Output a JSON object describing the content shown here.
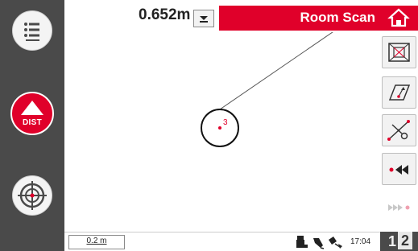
{
  "header": {
    "measurement_value": "0.652m",
    "title": "Room Scan"
  },
  "left_rail": {
    "dist_label": "DIST"
  },
  "canvas": {
    "point_label": "3"
  },
  "bottom_bar": {
    "scale_label": "0.2 m",
    "time": "17:04"
  },
  "page_indicator": {
    "page_one": "1",
    "page_two": "2"
  },
  "icons": {
    "menu": "list-menu-icon",
    "dist": "dist-measure-icon",
    "target": "crosshair-target-icon",
    "home": "home-icon",
    "room": "room-view-icon",
    "plane": "plane-icon",
    "tools": "scissors-tools-icon",
    "rewind": "rewind-icon",
    "forward": "forward-icon",
    "dropdown": "chevron-down-icon",
    "battery": "battery-icon",
    "probe": "probe-icon",
    "connect": "connection-icon"
  },
  "colors": {
    "accent": "#e0002a",
    "rail": "#4a4a4a"
  }
}
